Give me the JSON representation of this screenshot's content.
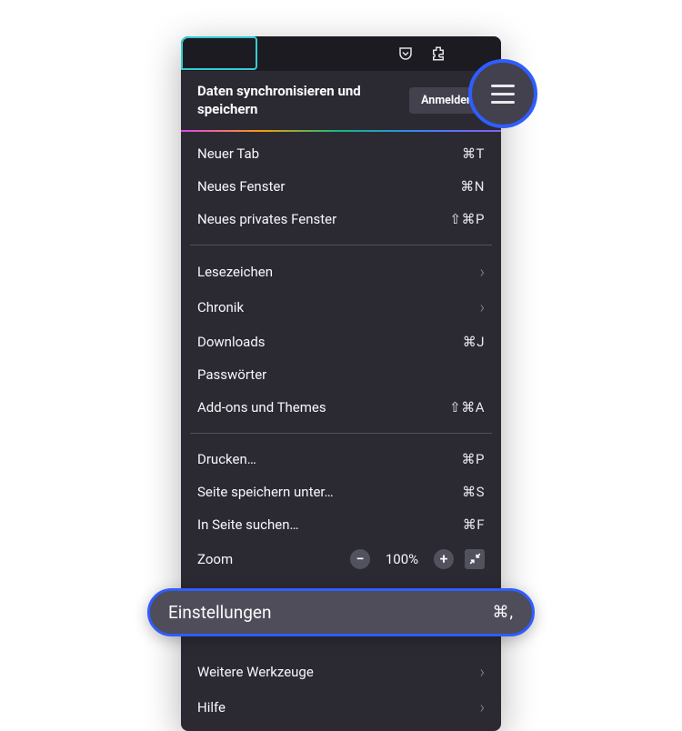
{
  "sync": {
    "title": "Daten synchronisieren und speichern",
    "signin": "Anmelden"
  },
  "items": {
    "newtab": {
      "label": "Neuer Tab",
      "shortcut": "⌘T"
    },
    "newwindow": {
      "label": "Neues Fenster",
      "shortcut": "⌘N"
    },
    "newprivate": {
      "label": "Neues privates Fenster",
      "shortcut": "⇧⌘P"
    },
    "bookmarks": {
      "label": "Lesezeichen"
    },
    "history": {
      "label": "Chronik"
    },
    "downloads": {
      "label": "Downloads",
      "shortcut": "⌘J"
    },
    "passwords": {
      "label": "Passwörter"
    },
    "addons": {
      "label": "Add-ons und Themes",
      "shortcut": "⇧⌘A"
    },
    "print": {
      "label": "Drucken…",
      "shortcut": "⌘P"
    },
    "savepage": {
      "label": "Seite speichern unter…",
      "shortcut": "⌘S"
    },
    "find": {
      "label": "In Seite suchen…",
      "shortcut": "⌘F"
    },
    "zoom": {
      "label": "Zoom",
      "value": "100%"
    },
    "settings": {
      "label": "Einstellungen",
      "shortcut": "⌘,"
    },
    "moretools": {
      "label": "Weitere Werkzeuge"
    },
    "help": {
      "label": "Hilfe"
    }
  }
}
